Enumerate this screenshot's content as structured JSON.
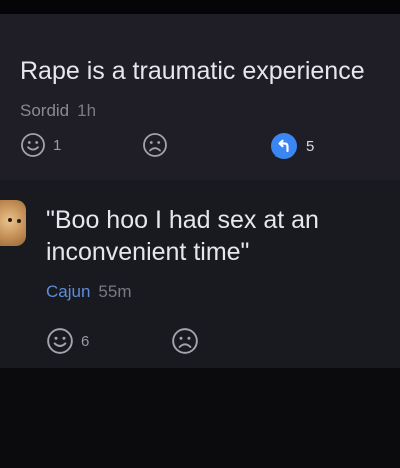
{
  "post": {
    "text": "Rape is a traumatic experience",
    "author": "Sordid",
    "time": "1h",
    "like_count": "1",
    "reply_count": "5",
    "icons": {
      "like": "smile-icon",
      "dislike": "frown-icon",
      "reply": "reply-arrow-icon"
    }
  },
  "reply": {
    "line1": "\"Boo hoo I had sex at an",
    "line2": "inconvenient time\"",
    "author": "Cajun",
    "time": "55m",
    "like_count": "6",
    "icons": {
      "like": "smile-icon",
      "dislike": "frown-icon"
    }
  },
  "colors": {
    "post_bg": "#1f1e26",
    "reply_bg": "#191920",
    "text": "#e7e6ec",
    "reply_author": "#5e8dd8",
    "reply_badge": "#3a86f2"
  }
}
